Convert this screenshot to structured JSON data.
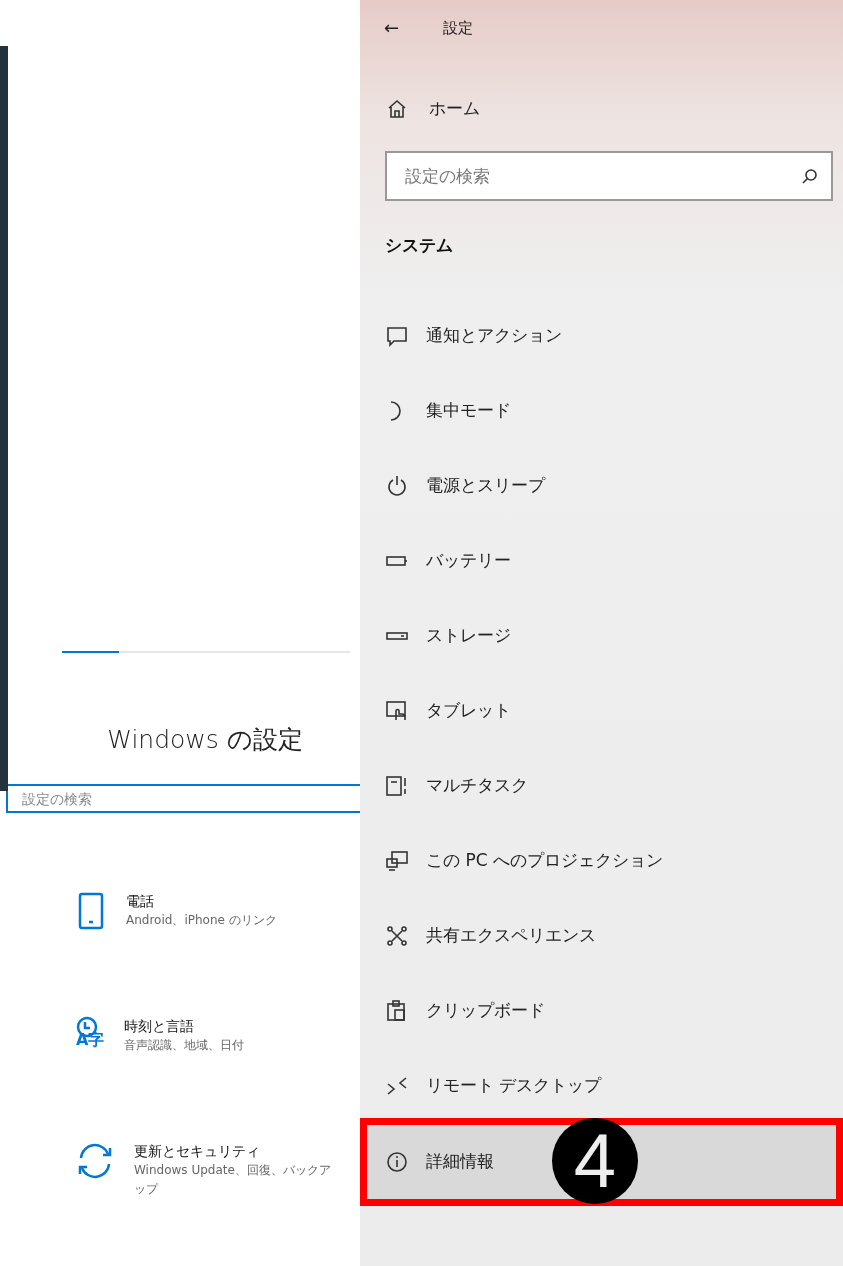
{
  "left_panel": {
    "title": "Windows の設定",
    "search": {
      "placeholder": "設定の検索"
    },
    "categories": [
      {
        "title": "電話",
        "subtitle": "Android、iPhone のリンク"
      },
      {
        "title": "時刻と言語",
        "icon_text": "A字",
        "subtitle": "音声認識、地域、日付"
      },
      {
        "title": "更新とセキュリティ",
        "subtitle": "Windows Update、回復、バックアップ"
      }
    ]
  },
  "settings_panel": {
    "header": {
      "back": "←",
      "title": "設定"
    },
    "home": {
      "label": "ホーム"
    },
    "search": {
      "placeholder": "設定の検索"
    },
    "section_title": "システム",
    "items": [
      {
        "label": "通知とアクション",
        "selected": false
      },
      {
        "label": "集中モード",
        "selected": false
      },
      {
        "label": "電源とスリープ",
        "selected": false
      },
      {
        "label": "バッテリー",
        "selected": false
      },
      {
        "label": "ストレージ",
        "selected": false
      },
      {
        "label": "タブレット",
        "selected": false
      },
      {
        "label": "マルチタスク",
        "selected": false
      },
      {
        "label": "この PC へのプロジェクション",
        "selected": false
      },
      {
        "label": "共有エクスペリエンス",
        "selected": false
      },
      {
        "label": "クリップボード",
        "selected": false
      },
      {
        "label": "リモート デスクトップ",
        "selected": false
      },
      {
        "label": "詳細情報",
        "selected": true,
        "callout": "4"
      }
    ]
  }
}
